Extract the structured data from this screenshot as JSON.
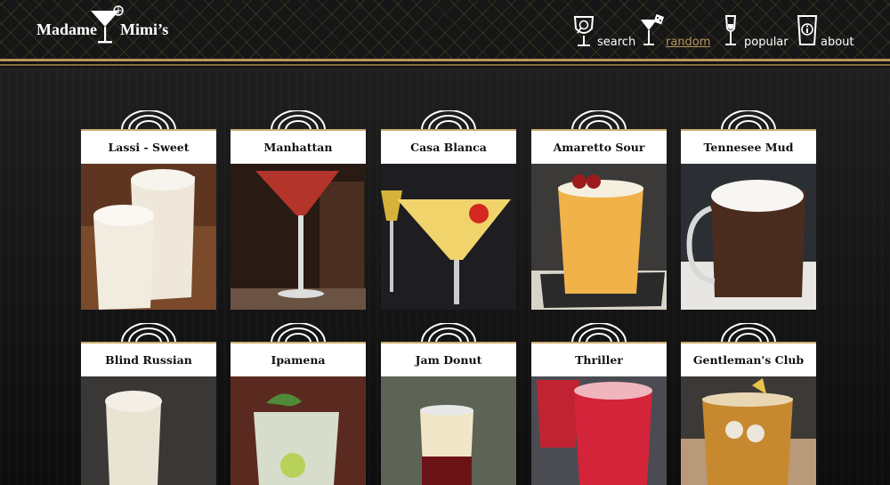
{
  "logo": {
    "word1": "Madame",
    "word2": "Mimi’s"
  },
  "nav": [
    {
      "label": "search",
      "icon": "magnifier-glass-icon",
      "active": false
    },
    {
      "label": "random",
      "icon": "cocktail-dice-icon",
      "active": true
    },
    {
      "label": "popular",
      "icon": "champagne-flute-icon",
      "active": false
    },
    {
      "label": "about",
      "icon": "info-glass-icon",
      "active": false
    }
  ],
  "colors": {
    "gold": "#b8965a",
    "background": "#111111",
    "card_title_bg": "#ffffff"
  },
  "drinks": [
    {
      "name": "Lassi - Sweet"
    },
    {
      "name": "Manhattan"
    },
    {
      "name": "Casa Blanca"
    },
    {
      "name": "Amaretto Sour"
    },
    {
      "name": "Tennesee Mud"
    },
    {
      "name": "Blind Russian"
    },
    {
      "name": "Ipamena"
    },
    {
      "name": "Jam Donut"
    },
    {
      "name": "Thriller"
    },
    {
      "name": "Gentleman's Club"
    }
  ]
}
